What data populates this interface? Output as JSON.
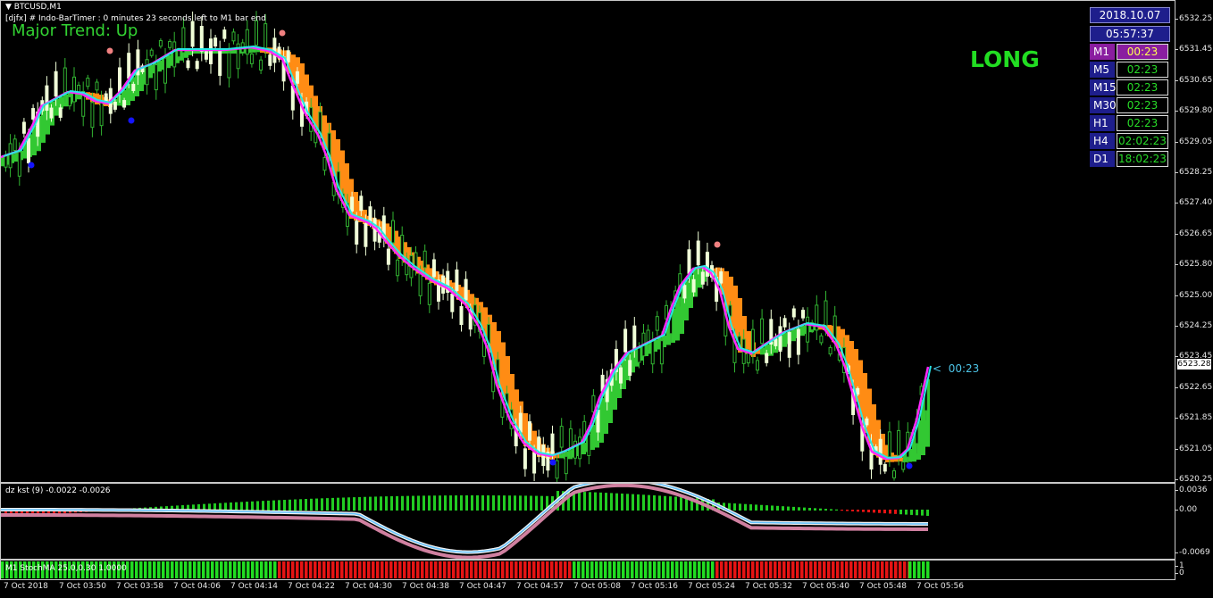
{
  "header": {
    "symbol": "BTCUSD,M1",
    "timer_text": "[djfx] # Indo-BarTimer :  0 minutes 23 seconds left to M1 bar end",
    "trend_text": "Major Trend: Up",
    "signal": "LONG",
    "countdown": "00:23",
    "current_price": "6523.28"
  },
  "colors": {
    "trend_green": "#32d232",
    "timer_cyan": "#4cc3e6",
    "bull_fill": "#32c832",
    "bear_fill": "#ff8c14",
    "ma_magenta": "#ff28ff",
    "ma_cyan": "#28e6e6"
  },
  "timeframes": {
    "date": "2018.10.07",
    "time": "05:57:37",
    "rows": [
      {
        "label": "M1",
        "value": "00:23",
        "active": true
      },
      {
        "label": "M5",
        "value": "02:23",
        "active": false
      },
      {
        "label": "M15",
        "value": "02:23",
        "active": false
      },
      {
        "label": "M30",
        "value": "02:23",
        "active": false
      },
      {
        "label": "H1",
        "value": "02:23",
        "active": false
      },
      {
        "label": "H4",
        "value": "02:02:23",
        "active": false
      },
      {
        "label": "D1",
        "value": "18:02:23",
        "active": false
      }
    ]
  },
  "price_axis": [
    "6532.25",
    "6531.45",
    "6530.65",
    "6529.80",
    "6529.05",
    "6528.25",
    "6527.40",
    "6526.65",
    "6525.80",
    "6525.00",
    "6524.25",
    "6523.45",
    "6522.65",
    "6521.85",
    "6521.05",
    "6520.25"
  ],
  "kst": {
    "title": "dz kst (9) -0.0022 -0.0026",
    "axis": [
      "0.0036",
      "0.00",
      "-0.0069"
    ]
  },
  "stoch": {
    "title": "M1 StochMA 25.0,0.30 1.0000",
    "axis": [
      "1",
      "0"
    ]
  },
  "time_axis": [
    "7 Oct 2018",
    "7 Oct 03:50",
    "7 Oct 03:58",
    "7 Oct 04:06",
    "7 Oct 04:14",
    "7 Oct 04:22",
    "7 Oct 04:30",
    "7 Oct 04:38",
    "7 Oct 04:47",
    "7 Oct 04:57",
    "7 Oct 05:08",
    "7 Oct 05:16",
    "7 Oct 05:24",
    "7 Oct 05:32",
    "7 Oct 05:40",
    "7 Oct 05:48",
    "7 Oct 05:56"
  ]
}
